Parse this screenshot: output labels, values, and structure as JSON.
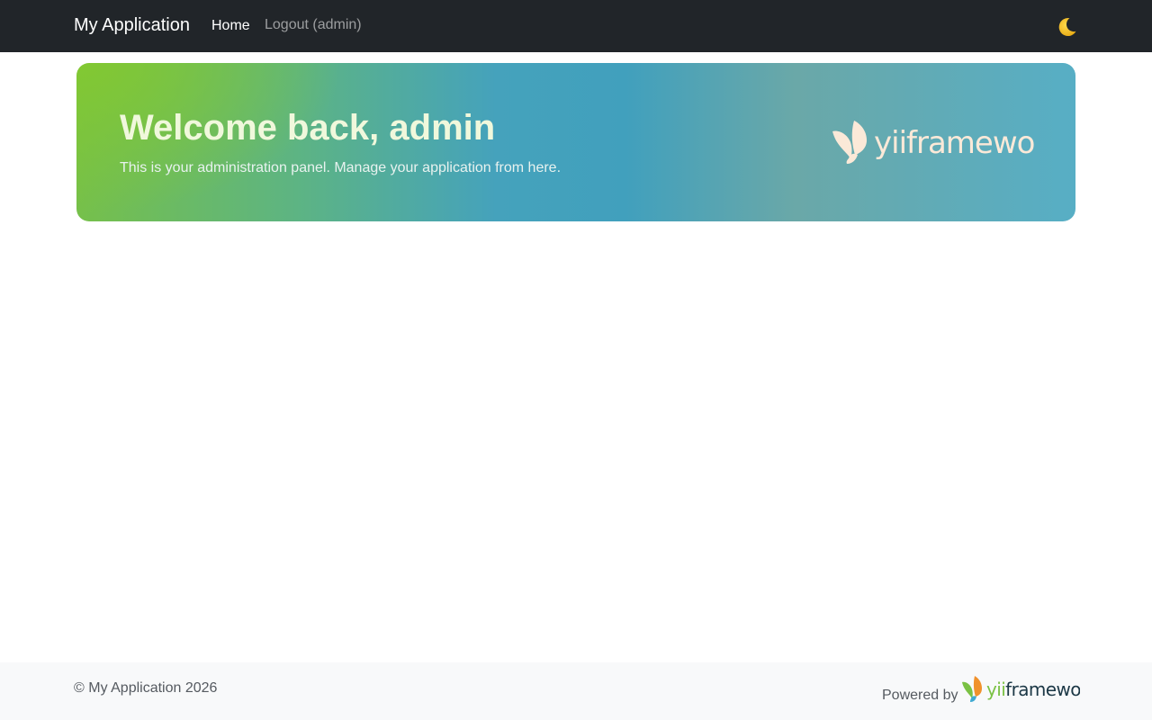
{
  "navbar": {
    "brand": "My Application",
    "links": [
      {
        "label": "Home",
        "active": true
      },
      {
        "label": "Logout (admin)",
        "active": false
      }
    ],
    "theme_toggle_icon": "crescent-moon-icon"
  },
  "hero": {
    "title": "Welcome back, admin",
    "subtitle": "This is your administration panel. Manage your application from here.",
    "logo_text": "yiiframework"
  },
  "footer": {
    "copyright": "© My Application 2026",
    "powered_by": "Powered by",
    "logo_text": "yiiframework"
  },
  "colors": {
    "navbar_bg": "#212529",
    "footer_bg": "#f8f9fa",
    "hero_green": "#76c04a",
    "hero_blue": "#41a0bd",
    "yii_orange": "#f0912c",
    "yii_green": "#7ac143",
    "yii_blue": "#3fa9d2",
    "yii_dark": "#1c3846"
  }
}
